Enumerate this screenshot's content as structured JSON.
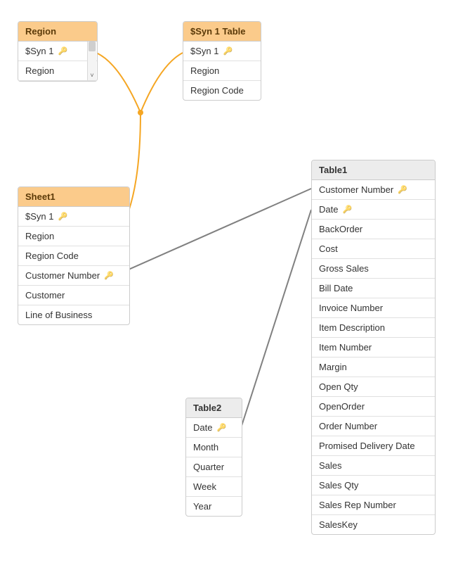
{
  "tables": {
    "region": {
      "title": "Region",
      "fields": [
        {
          "label": "$Syn 1",
          "key": true,
          "indent": false
        },
        {
          "label": "Region",
          "key": false,
          "indent": true
        }
      ]
    },
    "syn1": {
      "title": "$Syn 1 Table",
      "fields": [
        {
          "label": "$Syn 1",
          "key": true,
          "indent": false
        },
        {
          "label": "Region",
          "key": false,
          "indent": false
        },
        {
          "label": "Region Code",
          "key": false,
          "indent": false
        }
      ]
    },
    "sheet1": {
      "title": "Sheet1",
      "fields": [
        {
          "label": "$Syn 1",
          "key": true,
          "indent": false
        },
        {
          "label": "Region",
          "key": false,
          "indent": true
        },
        {
          "label": "Region Code",
          "key": false,
          "indent": true
        },
        {
          "label": "Customer Number",
          "key": true,
          "indent": false
        },
        {
          "label": "Customer",
          "key": false,
          "indent": false
        },
        {
          "label": "Line of Business",
          "key": false,
          "indent": false
        }
      ]
    },
    "table1": {
      "title": "Table1",
      "fields": [
        {
          "label": "Customer Number",
          "key": true,
          "indent": false
        },
        {
          "label": "Date",
          "key": true,
          "indent": false
        },
        {
          "label": "BackOrder",
          "key": false,
          "indent": false
        },
        {
          "label": "Cost",
          "key": false,
          "indent": false
        },
        {
          "label": "Gross Sales",
          "key": false,
          "indent": false
        },
        {
          "label": "Bill Date",
          "key": false,
          "indent": false
        },
        {
          "label": "Invoice Number",
          "key": false,
          "indent": false
        },
        {
          "label": "Item Description",
          "key": false,
          "indent": false
        },
        {
          "label": "Item Number",
          "key": false,
          "indent": false
        },
        {
          "label": "Margin",
          "key": false,
          "indent": false
        },
        {
          "label": "Open Qty",
          "key": false,
          "indent": false
        },
        {
          "label": "OpenOrder",
          "key": false,
          "indent": false
        },
        {
          "label": "Order Number",
          "key": false,
          "indent": false
        },
        {
          "label": "Promised Delivery Date",
          "key": false,
          "indent": false
        },
        {
          "label": "Sales",
          "key": false,
          "indent": false
        },
        {
          "label": "Sales Qty",
          "key": false,
          "indent": false
        },
        {
          "label": "Sales Rep Number",
          "key": false,
          "indent": false
        },
        {
          "label": "SalesKey",
          "key": false,
          "indent": false
        }
      ]
    },
    "table2": {
      "title": "Table2",
      "fields": [
        {
          "label": "Date",
          "key": true,
          "indent": false
        },
        {
          "label": "Month",
          "key": false,
          "indent": false
        },
        {
          "label": "Quarter",
          "key": false,
          "indent": false
        },
        {
          "label": "Week",
          "key": false,
          "indent": false
        },
        {
          "label": "Year",
          "key": false,
          "indent": false
        }
      ]
    }
  },
  "colors": {
    "orange_line": "#f5a623",
    "grey_line": "#808080"
  },
  "icons": {
    "key": "🔑",
    "chevron_up": "˄",
    "chevron_down": "˅"
  }
}
